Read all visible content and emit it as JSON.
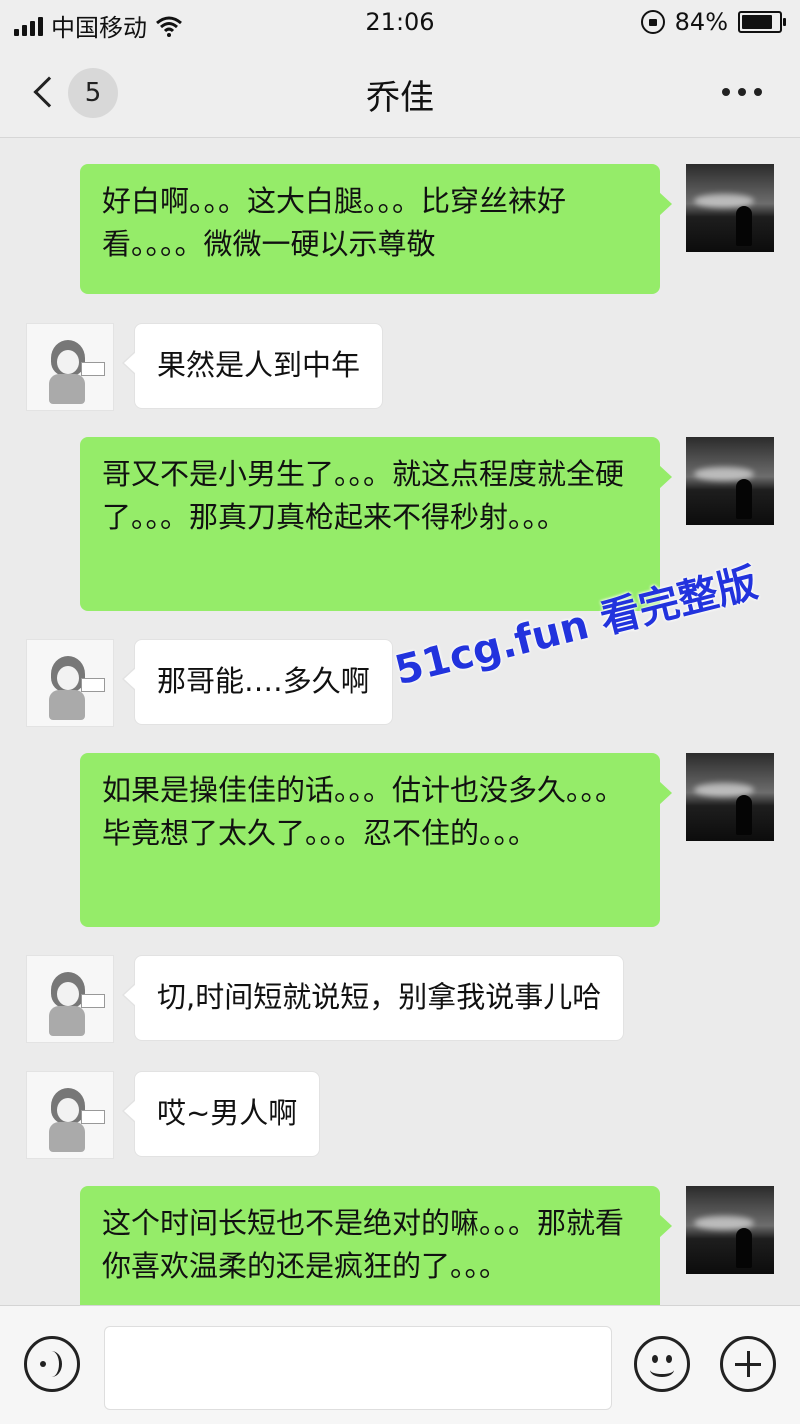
{
  "status_bar": {
    "carrier": "中国移动",
    "time": "21:06",
    "battery": "84%",
    "battery_level": 0.84,
    "icons": [
      "signal-icon",
      "wifi-icon",
      "rotation-lock-icon",
      "battery-icon"
    ]
  },
  "nav": {
    "back_badge": "5",
    "title": "乔佳",
    "icons": [
      "chevron-left-icon",
      "more-icon"
    ]
  },
  "messages": [
    {
      "from": "me",
      "text": "好白啊。。。这大白腿。。。比穿丝袜好看。。。。微微一硬以示尊敬"
    },
    {
      "from": "her",
      "text": "果然是人到中年"
    },
    {
      "from": "me",
      "text": "哥又不是小男生了。。。就这点程度就全硬了。。。那真刀真枪起来不得秒射。。。"
    },
    {
      "from": "her",
      "text": "那哥能‥‥多久啊"
    },
    {
      "from": "me",
      "text": "如果是操佳佳的话。。。估计也没多久。。。毕竟想了太久了。。。忍不住的。。。"
    },
    {
      "from": "her",
      "text": "切,时间短就说短，别拿我说事儿哈"
    },
    {
      "from": "her",
      "text": "哎~男人啊"
    },
    {
      "from": "me",
      "text": "这个时间长短也不是绝对的嘛。。。那就看你喜欢温柔的还是疯狂的了。。。"
    }
  ],
  "watermark": "51cg.fun 看完整版",
  "input_bar": {
    "icons": [
      "voice-icon",
      "emoji-icon",
      "plus-icon"
    ]
  },
  "colors": {
    "my_bubble": "#95ec69",
    "her_bubble": "#ffffff",
    "background": "#ebebeb",
    "watermark": "#2233dd"
  }
}
